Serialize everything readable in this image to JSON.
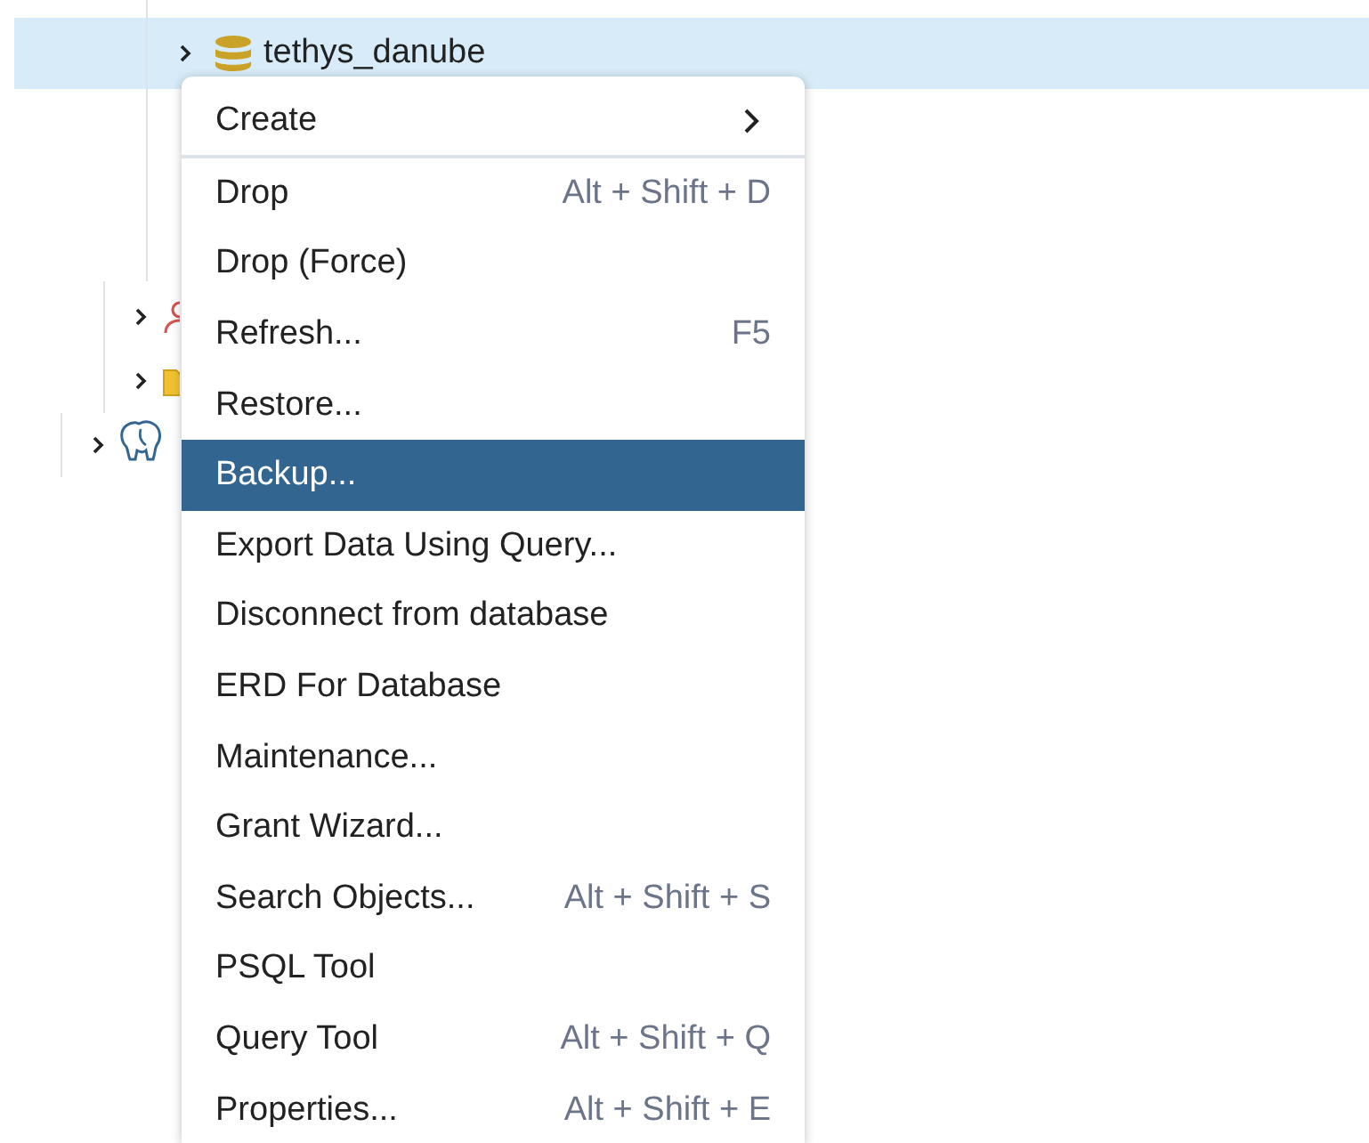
{
  "tree": [
    {
      "kind": "database",
      "label": "tethys_danube",
      "selected": true,
      "expanded": false
    },
    {
      "kind": "roles",
      "expanded": false
    },
    {
      "kind": "tablespaces",
      "expanded": false
    },
    {
      "kind": "server",
      "expanded": false
    }
  ],
  "context_menu": [
    {
      "label": "Create",
      "submenu": true,
      "selected": false
    },
    {
      "label": "Drop",
      "shortcut": "Alt + Shift + D",
      "selected": false
    },
    {
      "label": "Drop (Force)",
      "selected": false
    },
    {
      "label": "Refresh...",
      "shortcut": "F5",
      "selected": false
    },
    {
      "label": "Restore...",
      "selected": false
    },
    {
      "label": "Backup...",
      "selected": true
    },
    {
      "label": "Export Data Using Query...",
      "selected": false
    },
    {
      "label": "Disconnect from database",
      "selected": false
    },
    {
      "label": "ERD For Database",
      "selected": false
    },
    {
      "label": "Maintenance...",
      "selected": false
    },
    {
      "label": "Grant Wizard...",
      "selected": false
    },
    {
      "label": "Search Objects...",
      "shortcut": "Alt + Shift + S",
      "selected": false
    },
    {
      "label": "PSQL Tool",
      "selected": false
    },
    {
      "label": "Query Tool",
      "shortcut": "Alt + Shift + Q",
      "selected": false
    },
    {
      "label": "Properties...",
      "shortcut": "Alt + Shift + E",
      "selected": false
    }
  ]
}
